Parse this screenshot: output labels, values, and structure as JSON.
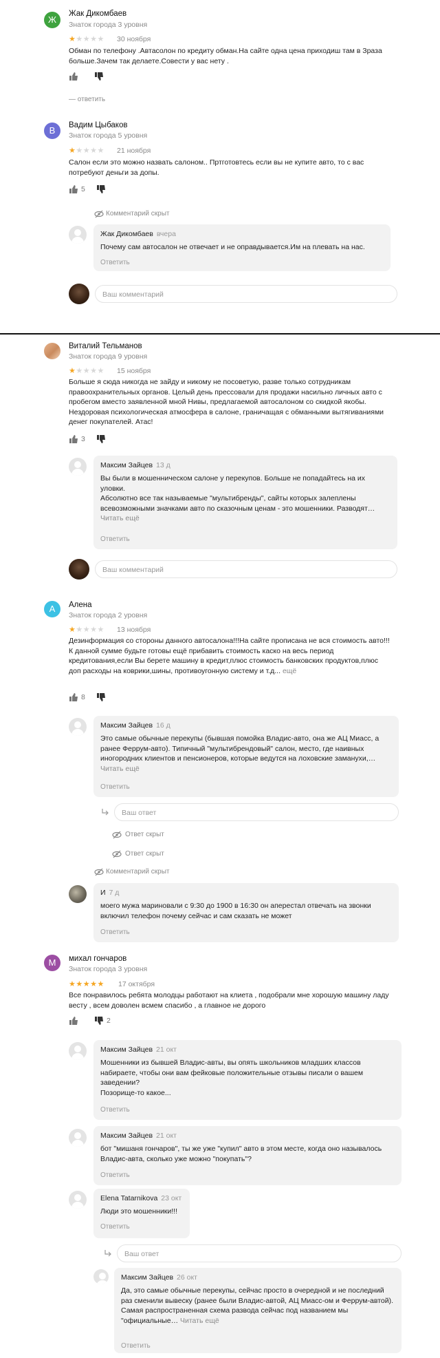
{
  "reviews": [
    {
      "name": "Жак Дикомбаев",
      "level": "Знаток города 3 уровня",
      "avatar_letter": "Ж",
      "stars": 1,
      "date": "30 ноября",
      "text": "Обман по телефону .Автасолон по кредиту обман.На сайте одна цена приходиш там в Зраза больше.Зачем так делаете.Совести у вас нету .",
      "reply_link": "— ответить"
    },
    {
      "name": "Вадим Цыбаков",
      "level": "Знаток города 5 уровня",
      "avatar_letter": "В",
      "stars": 1,
      "date": "21 ноября",
      "text": "Салон если это можно назвать салоном.. Пртготовтесь если вы не купите авто, то с вас потребуют деньги за допы.",
      "likes": "5",
      "hidden_label": "Комментарий скрыт",
      "comments": [
        {
          "name": "Жак Дикомбаев",
          "time": "вчера",
          "text": "Почему сам автосалон не отвечает и не оправдывается.Им на плевать на нас.",
          "reply": "Ответить"
        }
      ],
      "input_placeholder": "Ваш комментарий"
    },
    {
      "name": "Виталий Тельманов",
      "level": "Знаток города 9 уровня",
      "stars": 1,
      "date": "15 ноября",
      "text": "Больше я сюда никогда не зайду и никому не посоветую, разве только сотрудникам правоохранительных органов. Целый день прессовали для продажи насильно личных авто с пробегом вместо заявленной мной Нивы, предлагаемой автосалоном со скидкой якобы. Нездоровая психологическая атмосфера в салоне, граничащая с обманными вытягиваниями денег покупателей. Атас!",
      "likes": "3",
      "comments": [
        {
          "name": "Максим Зайцев",
          "time": "13 д",
          "text": "Вы были в мошенническом салоне у перекупов. Больше не попадайтесь на их уловки.\nАбсолютно все так называемые \"мультибренды\", сайты которых залеплены всевозможными значками авто по сказочным ценам - это мошенники. Разводят…",
          "more": "Читать ещё",
          "reply": "Ответить"
        }
      ],
      "input_placeholder": "Ваш комментарий"
    },
    {
      "name": "Алена",
      "level": "Знаток города 2 уровня",
      "avatar_letter": "А",
      "stars": 1,
      "date": "13 ноября",
      "text": "Дезинформация со стороны данного автосалона!!!На сайте прописана не вся стоимость авто!!!К данной сумме будьте готовы ещё прибавить стоимость каско на весь период кредитования,если Вы берете машину в кредит,плюс стоимость банковских продуктов,плюс доп расходы на коврики,шины, противоугонную систему и т.д...",
      "more": "ещё",
      "likes": "8",
      "comments": [
        {
          "name": "Максим Зайцев",
          "time": "16 д",
          "text": "Это самые обычные перекупы (бывшая помойка Владис-авто, она же АЦ Миасс, а ранее Феррум-авто). Типичный \"мультибрендовый\" салон, место, где наивных иногородних клиентов и пенсионеров, которые ведутся на лоховские заманухи,…",
          "more": "Читать ещё",
          "reply": "Ответить"
        }
      ],
      "answer_placeholder": "Ваш ответ",
      "hidden_answers": [
        "Ответ скрыт",
        "Ответ скрыт"
      ],
      "hidden_comment": "Комментарий скрыт",
      "comment2": {
        "name": "И",
        "time": "7 д",
        "text": "моего мужа мариновали с 9:30 до 1900 в 16:30  он аперестал отвечать на звонки включил телефон почему сейчас и сам сказать не может",
        "reply": "Ответить"
      }
    },
    {
      "name": "михал гончаров",
      "level": "Знаток города 3 уровня",
      "avatar_letter": "М",
      "stars": 5,
      "date": "17 октября",
      "text": "Все понравилось ребята молодцы работают на клиета , подобрали мне хорошую машину ладу весту , всем доволен всмем спасибо , а главное не дорого",
      "dislikes": "2",
      "comments": [
        {
          "name": "Максим Зайцев",
          "time": "21 окт",
          "text": "Мошенники из бывшей Владис-авты, вы опять школьников младших классов набираете, чтобы они вам фейковые положительные отзывы писали о вашем заведении?\nПозорище-то какое...",
          "reply": "Ответить"
        },
        {
          "name": "Максим Зайцев",
          "time": "21 окт",
          "text": "бот \"мишаня гончаров\", ты же уже \"купил\" авто в этом месте, когда оно называлось Владис-авта, сколько уже можно \"покупать\"?",
          "reply": "Ответить"
        },
        {
          "name": "Elena Tatarnikova",
          "time": "23 окт",
          "text": "Люди это мошенники!!!",
          "reply": "Ответить"
        }
      ],
      "answer_placeholder": "Ваш ответ",
      "nested": {
        "name": "Максим Зайцев",
        "time": "26 окт",
        "text": "Да, это самые обычные перекупы, сейчас просто в очередной и не последний раз сменили вывеску (ранее были Владис-автой, АЦ Миасс-ом и Феррум-автой). Самая распространенная схема развода сейчас под названием мы \"официальные…",
        "more": "Читать ещё",
        "reply": "Ответить"
      }
    }
  ],
  "colors": {
    "star": "#f5a623",
    "star_off": "#d7d7d7",
    "muted": "#8a8a8a",
    "bubble": "#f2f2f2"
  }
}
